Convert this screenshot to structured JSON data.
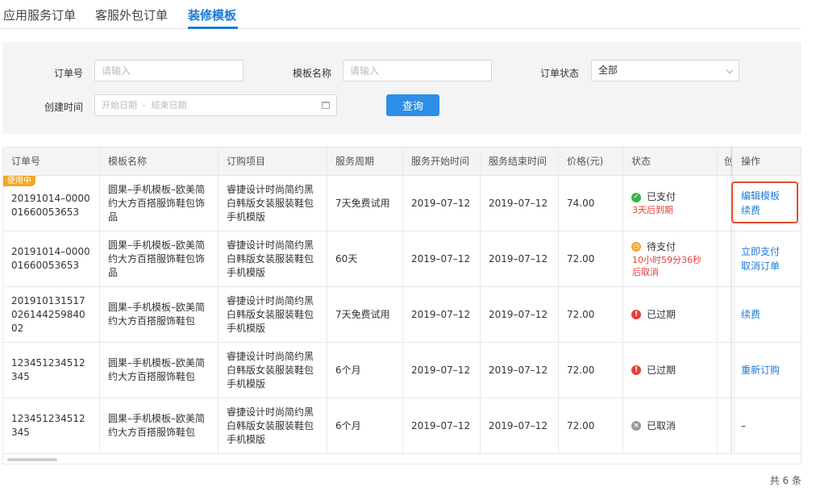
{
  "tabs": [
    {
      "label": "应用服务订单"
    },
    {
      "label": "客服外包订单"
    },
    {
      "label": "装修模板"
    }
  ],
  "filters": {
    "order_no": {
      "label": "订单号",
      "placeholder": "请输入"
    },
    "template_name": {
      "label": "模板名称",
      "placeholder": "请输入"
    },
    "order_status": {
      "label": "订单状态",
      "value": "全部"
    },
    "created_time": {
      "label": "创建时间",
      "start_placeholder": "开始日期",
      "separator": "–",
      "end_placeholder": "结束日期"
    },
    "query_button": "查询"
  },
  "table": {
    "columns": [
      "订单号",
      "模板名称",
      "订购项目",
      "服务周期",
      "服务开始时间",
      "服务结束时间",
      "价格(元)",
      "状态",
      "创",
      "操作"
    ],
    "rows": [
      {
        "badge": "使用中",
        "order_no": "20191014–000001660053653",
        "template": "圆果–手机模板–欧美简约大方百搭服饰鞋包饰品",
        "item": "睿捷设计时尚简约黑白韩版女装服装鞋包手机模版",
        "period": "7天免费试用",
        "start": "2019–07–12",
        "end": "2019–07–12",
        "price": "74.00",
        "status": "已支付",
        "status_type": "ok",
        "status_note": "3天后到期",
        "actions": [
          "编辑模板",
          "续费"
        ]
      },
      {
        "badge": "",
        "order_no": "20191014–000001660053653",
        "template": "圆果–手机模板–欧美简约大方百搭服饰鞋包饰品",
        "item": "睿捷设计时尚简约黑白韩版女装服装鞋包手机模版",
        "period": "60天",
        "start": "2019–07–12",
        "end": "2019–07–12",
        "price": "72.00",
        "status": "待支付",
        "status_type": "wait",
        "status_note": "10小时59分36秒后取消",
        "actions": [
          "立即支付",
          "取消订单"
        ]
      },
      {
        "badge": "",
        "order_no": "20191013151702614425984002",
        "template": "圆果–手机模板–欧美简约大方百搭服饰鞋包",
        "item": "睿捷设计时尚简约黑白韩版女装服装鞋包手机模版",
        "period": "7天免费试用",
        "start": "2019–07–12",
        "end": "2019–07–12",
        "price": "72.00",
        "status": "已过期",
        "status_type": "exp",
        "status_note": "",
        "actions": [
          "续费"
        ]
      },
      {
        "badge": "",
        "order_no": "123451234512345",
        "template": "圆果–手机模板–欧美简约大方百搭服饰鞋包",
        "item": "睿捷设计时尚简约黑白韩版女装服装鞋包手机模版",
        "period": "6个月",
        "start": "2019–07–12",
        "end": "2019–07–12",
        "price": "72.00",
        "status": "已过期",
        "status_type": "exp",
        "status_note": "",
        "actions": [
          "重新订购"
        ]
      },
      {
        "badge": "",
        "order_no": "123451234512345",
        "template": "圆果–手机模板–欧美简约大方百搭服饰鞋包",
        "item": "睿捷设计时尚简约黑白韩版女装服装鞋包手机模版",
        "period": "6个月",
        "start": "2019–07–12",
        "end": "2019–07–12",
        "price": "72.00",
        "status": "已取消",
        "status_type": "cancel",
        "status_note": "",
        "actions": [
          "–"
        ]
      }
    ]
  },
  "footer": {
    "total": "共 6 条"
  },
  "colors": {
    "accent": "#1a7ad9",
    "button": "#2d8ee6",
    "ok": "#3bb54a",
    "wait": "#f5a623",
    "expired": "#e5403a",
    "cancelled": "#9a9a9a",
    "highlight": "#e0502f"
  }
}
